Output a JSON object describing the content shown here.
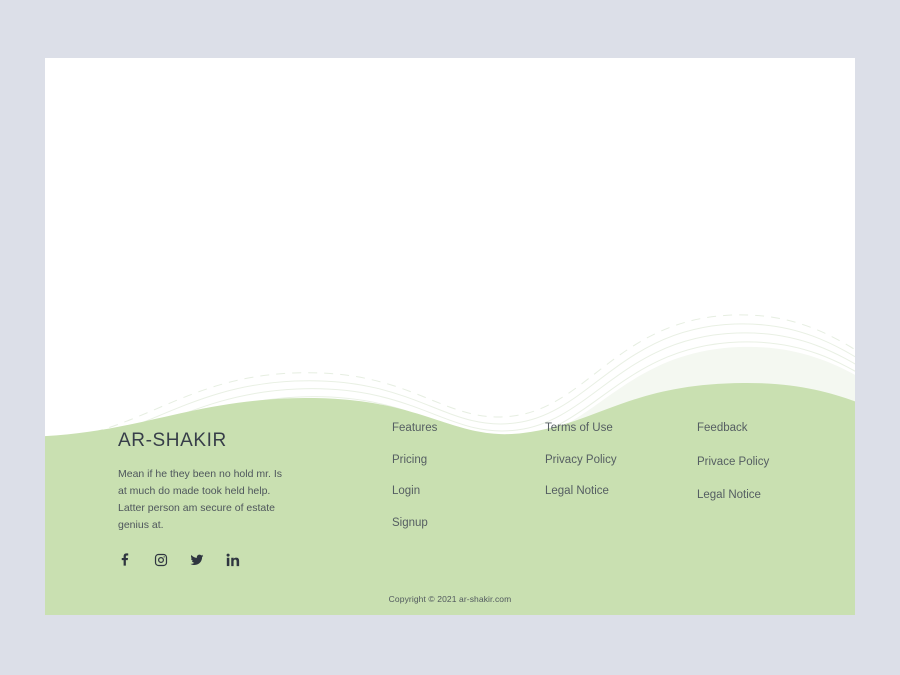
{
  "page": {
    "background_color": "#dcdfe8",
    "card_background_color": "#ffffff",
    "footer_color": "#c9e0b1",
    "wave_line_color": "#e3ece0",
    "heading_color": "#373e49",
    "link_color": "#555e62"
  },
  "footer": {
    "brand": {
      "title": "AR-SHAKIR",
      "description": "Mean if he they been no hold mr. Is at much do made took held help. Latter person am secure of estate genius at.",
      "social": [
        {
          "name": "facebook-icon",
          "label": "Facebook"
        },
        {
          "name": "instagram-icon",
          "label": "Instagram"
        },
        {
          "name": "twitter-icon",
          "label": "Twitter"
        },
        {
          "name": "linkedin-icon",
          "label": "LinkedIn"
        }
      ]
    },
    "columns": [
      {
        "id": "product",
        "links": [
          "Features",
          "Pricing",
          "Login",
          "Signup"
        ]
      },
      {
        "id": "legal",
        "links": [
          "Terms of Use",
          "Privacy Policy",
          "Legal Notice"
        ]
      },
      {
        "id": "support",
        "links": [
          "Feedback",
          "Privace Policy",
          "Legal Notice"
        ]
      }
    ],
    "copyright": "Copyright © 2021 ar-shakir.com"
  }
}
